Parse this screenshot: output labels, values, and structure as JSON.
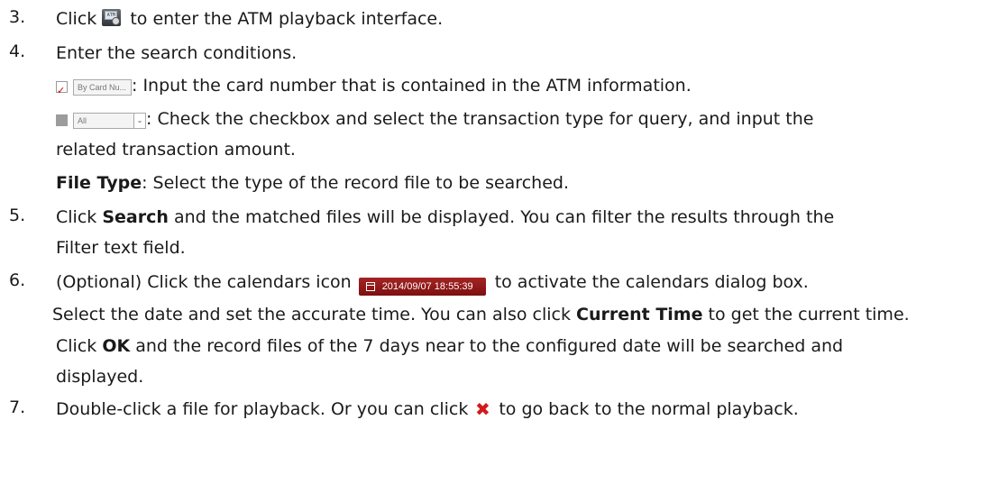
{
  "steps": [
    {
      "num": "3.",
      "pre": "Click",
      "post": "to enter the ATM playback interface.",
      "icon": "atm-icon"
    },
    {
      "num": "4.",
      "text": "Enter the search conditions."
    }
  ],
  "card_ctrl": {
    "input_placeholder": "By Card Nu...",
    "desc": ": Input the card number that is contained in the ATM information."
  },
  "amount_ctrl": {
    "select_value": "All",
    "desc_line1": ": Check the checkbox and select the transaction type for query, and input the",
    "desc_line2": "related transaction amount."
  },
  "file_type": {
    "label": "File Type",
    "desc": ": Select the type of the record file to be searched."
  },
  "step5": {
    "num": "5.",
    "pre": "Click",
    "bold": "Search",
    "line1_rest": "and the matched files will be displayed. You can filter the results through the",
    "line2": "Filter text field."
  },
  "step6": {
    "num": "6.",
    "pre": "(Optional) Click the calendars icon",
    "date_btn": "2014/09/07 18:55:39",
    "post": "to activate the calendars dialog box.",
    "line2_pre": "Select the date and set the accurate time. You can also click",
    "line2_bold": "Current Time",
    "line2_post": "to get the current time.",
    "line3_pre": "Click",
    "line3_bold": "OK",
    "line3_rest": "and the record files of the 7 days near to the configured date will be searched and",
    "line4": "displayed."
  },
  "step7": {
    "num": "7.",
    "pre": "Double-click a file for playback. Or you can click",
    "post": "to go back to the normal playback."
  },
  "colors": {
    "accent_red": "#8f1515",
    "close_red": "#d11a1a"
  }
}
